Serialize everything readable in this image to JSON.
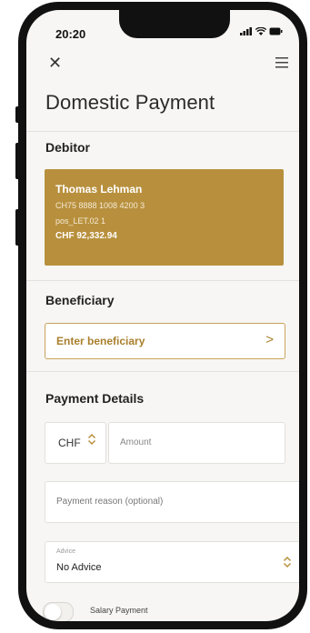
{
  "status": {
    "time": "20:20"
  },
  "header": {
    "title": "Domestic Payment"
  },
  "debitor": {
    "section_label": "Debitor",
    "name": "Thomas Lehman",
    "iban": "CH75 8888 1008 4200 3",
    "reference": "pos_LET.02 1",
    "balance": "CHF 92,332.94"
  },
  "beneficiary": {
    "section_label": "Beneficiary",
    "placeholder": "Enter beneficiary"
  },
  "payment_details": {
    "section_label": "Payment Details",
    "currency": "CHF",
    "amount_placeholder": "Amount",
    "reason_placeholder": "Payment reason (optional)",
    "advice_label": "Advice",
    "advice_value": "No Advice",
    "salary_label": "Salary Payment",
    "salary_enabled": false
  },
  "colors": {
    "accent": "#b8903d",
    "accent_text": "#a97f2c",
    "background": "#f7f6f4"
  },
  "icons": [
    "close-icon",
    "menu-icon",
    "chevron-right-icon",
    "updown-chevron-icon",
    "signal-icon",
    "wifi-icon",
    "battery-icon"
  ]
}
